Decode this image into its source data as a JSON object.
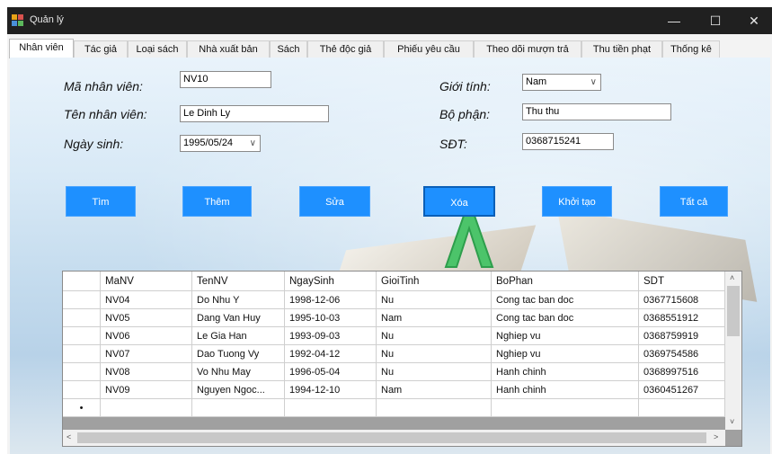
{
  "window": {
    "title": "Quản lý"
  },
  "tabs": [
    "Nhân viên",
    "Tác giả",
    "Loại sách",
    "Nhà xuất bản",
    "Sách",
    "Thẻ độc giả",
    "Phiếu yêu cầu",
    "Theo dõi mượn trả",
    "Thu tiền phạt",
    "Thống kê"
  ],
  "form": {
    "manv_label": "Mã nhân viên:",
    "manv_value": "NV10",
    "tennv_label": "Tên nhân viên:",
    "tennv_value": "Le Dinh Ly",
    "ngaysinh_label": "Ngày sinh:",
    "ngaysinh_value": "1995/05/24",
    "gioitinh_label": "Giới tính:",
    "gioitinh_value": "Nam",
    "bophan_label": "Bộ phận:",
    "bophan_value": "Thu thu",
    "sdt_label": "SĐT:",
    "sdt_value": "0368715241"
  },
  "buttons": {
    "tim": "Tìm",
    "them": "Thêm",
    "sua": "Sửa",
    "xoa": "Xóa",
    "khoitao": "Khởi tạo",
    "tatca": "Tất cả"
  },
  "grid": {
    "columns": [
      "MaNV",
      "TenNV",
      "NgaySinh",
      "GioiTinh",
      "BoPhan",
      "SDT"
    ],
    "rows": [
      [
        "NV04",
        "Do Nhu Y",
        "1998-12-06",
        "Nu",
        "Cong tac ban doc",
        "0367715608"
      ],
      [
        "NV05",
        "Dang Van Huy",
        "1995-10-03",
        "Nam",
        "Cong tac ban doc",
        "0368551912"
      ],
      [
        "NV06",
        "Le Gia Han",
        "1993-09-03",
        "Nu",
        "Nghiep vu",
        "0368759919"
      ],
      [
        "NV07",
        "Dao Tuong Vy",
        "1992-04-12",
        "Nu",
        "Nghiep vu",
        "0369754586"
      ],
      [
        "NV08",
        "Vo Nhu May",
        "1996-05-04",
        "Nu",
        "Hanh chinh",
        "0368997516"
      ],
      [
        "NV09",
        "Nguyen Ngoc...",
        "1994-12-10",
        "Nam",
        "Hanh chinh",
        "0360451267"
      ]
    ],
    "new_row_marker": "•"
  },
  "icons": {
    "minimize": "minimize-icon",
    "maximize": "maximize-icon",
    "close": "close-icon"
  },
  "colors": {
    "titlebar": "#202020",
    "button": "#1e90ff"
  }
}
